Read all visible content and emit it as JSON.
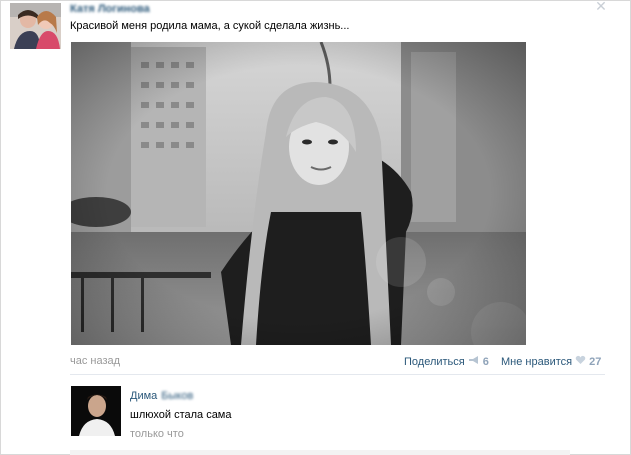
{
  "post": {
    "author_name": "Катя Логинова",
    "text": "Красивой меня родила мама, а сукой сделала жизнь...",
    "time": "час назад",
    "share_label": "Поделиться",
    "share_count": "6",
    "like_label": "Мне нравится",
    "like_count": "27"
  },
  "comment": {
    "author_first": "Дима",
    "author_last": "Быков",
    "text": "шлюхой стала сама",
    "time": "только что"
  },
  "icons": {
    "close": "close-icon",
    "share": "megaphone-icon",
    "like": "heart-icon"
  },
  "colors": {
    "link": "#2b587a",
    "muted": "#999999",
    "count": "#8fa3b9"
  }
}
